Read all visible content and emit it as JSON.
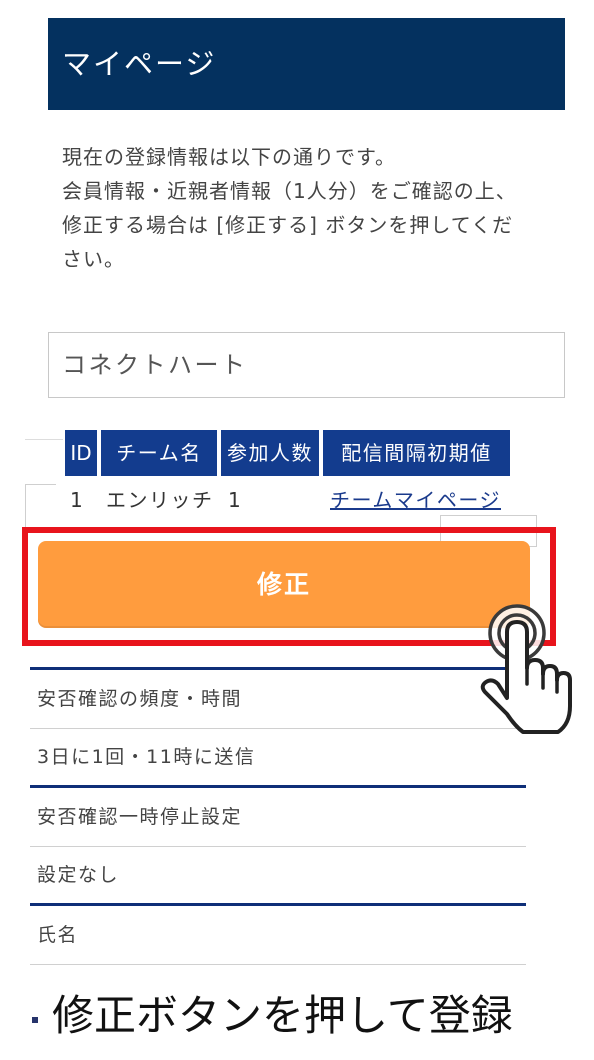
{
  "header": {
    "title": "マイページ"
  },
  "intro": {
    "line1": "現在の登録情報は以下の通りです。",
    "line2": "会員情報・近親者情報（1人分）をご確認の上、",
    "line3": "修正する場合は [修正する] ボタンを押してくだ",
    "line4": "さい。"
  },
  "team_field": {
    "value": "コネクトハート"
  },
  "team_table": {
    "headers": [
      "ID",
      "チーム名",
      "参加人数",
      "配信間隔初期値"
    ],
    "rows": [
      {
        "id": "1",
        "team_name": "エンリッチ",
        "members": "1",
        "link_label": "チームマイページ"
      }
    ]
  },
  "edit_button": {
    "label": "修正"
  },
  "settings": [
    {
      "label": "安否確認の頻度・時間",
      "value": "3日に1回・11時に送信"
    },
    {
      "label": "安否確認一時停止設定",
      "value": "設定なし"
    },
    {
      "label": "氏名"
    }
  ],
  "caption": {
    "text": "修正ボタンを押して登録"
  },
  "icons": {
    "tap_hint": "pointer-hand-click-icon"
  },
  "colors": {
    "header_bg": "#04315f",
    "table_header_bg": "#133c8e",
    "button_bg": "#ff9c3e",
    "highlight": "#e8141c",
    "divider_blue": "#0e2f78",
    "link": "#1a3a8c"
  }
}
